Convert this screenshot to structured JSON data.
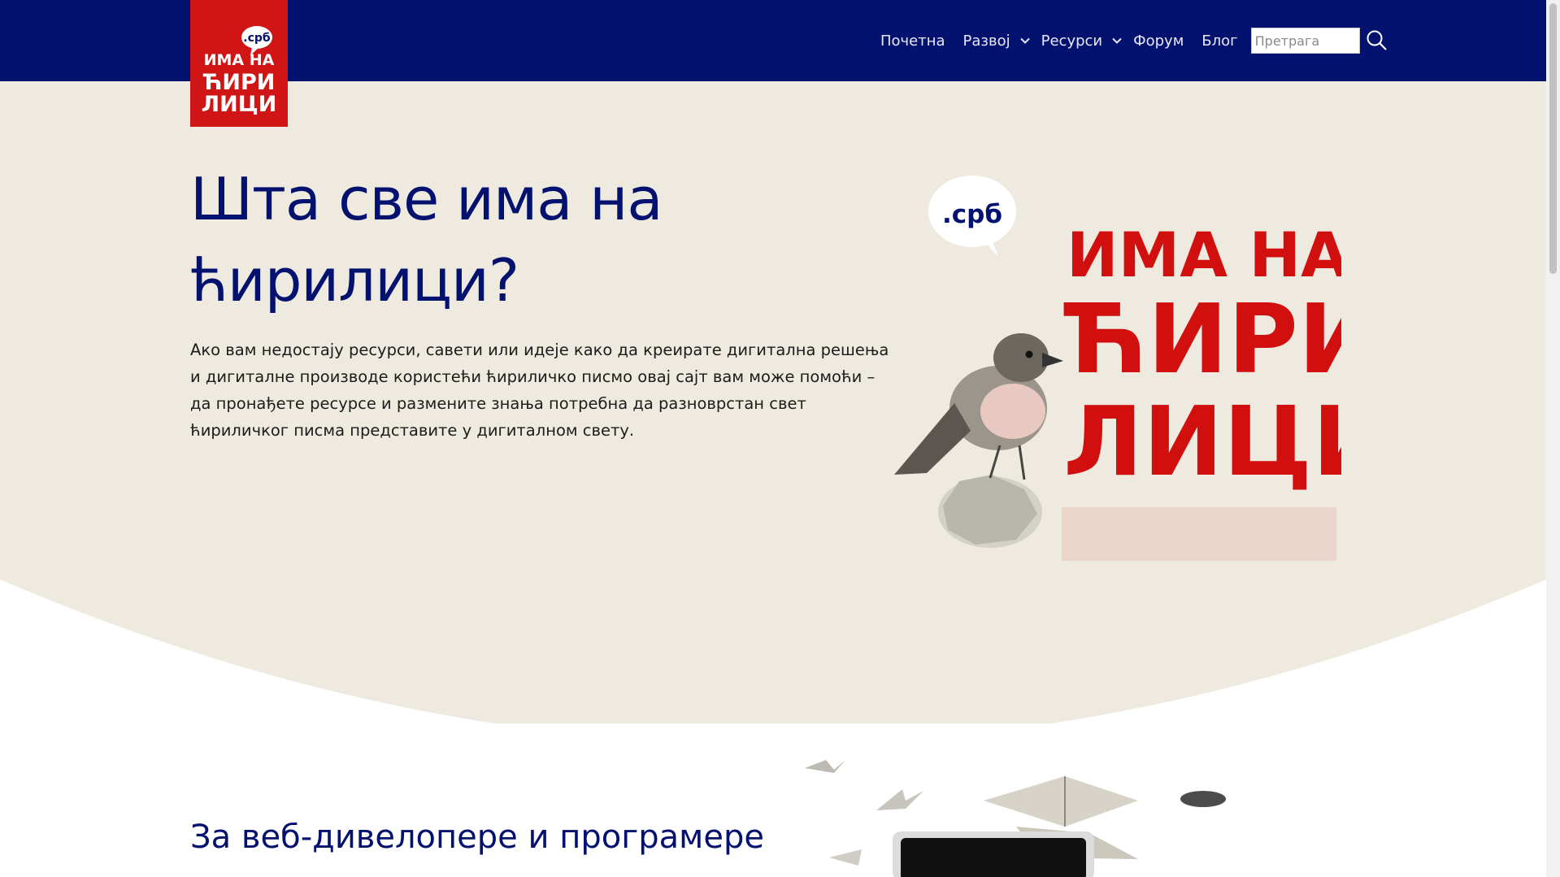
{
  "brand": {
    "domain": ".срб",
    "line1": "ИМА НА",
    "line2": "ЋИРИ",
    "line3": "ЛИЦИ",
    "colors": {
      "navy": "#03116f",
      "red": "#cf1515",
      "cream": "#efeadf"
    }
  },
  "nav": {
    "items": [
      {
        "label": "Почетна",
        "dropdown": false
      },
      {
        "label": "Развој",
        "dropdown": true
      },
      {
        "label": "Ресурси",
        "dropdown": true
      },
      {
        "label": "Форум",
        "dropdown": false
      },
      {
        "label": "Блог",
        "dropdown": false
      }
    ],
    "search": {
      "placeholder": "Претрага",
      "value": ""
    }
  },
  "hero": {
    "title": "Шта све има на ћирилици?",
    "text": "Ако вам недостају ресурси, савети или идеје како да креирате дигитална решења и дигиталне производе користећи ћириличко писмо овај сајт вам може помоћи – да пронађете ресурсе и размените знања потребна да разноврстан свет ћириличког писма представите у дигиталном свету."
  },
  "section": {
    "title": "За веб-дивелопере и програмере"
  },
  "icons": {
    "search": "search-icon",
    "dropdown": "chevron-down-icon"
  }
}
